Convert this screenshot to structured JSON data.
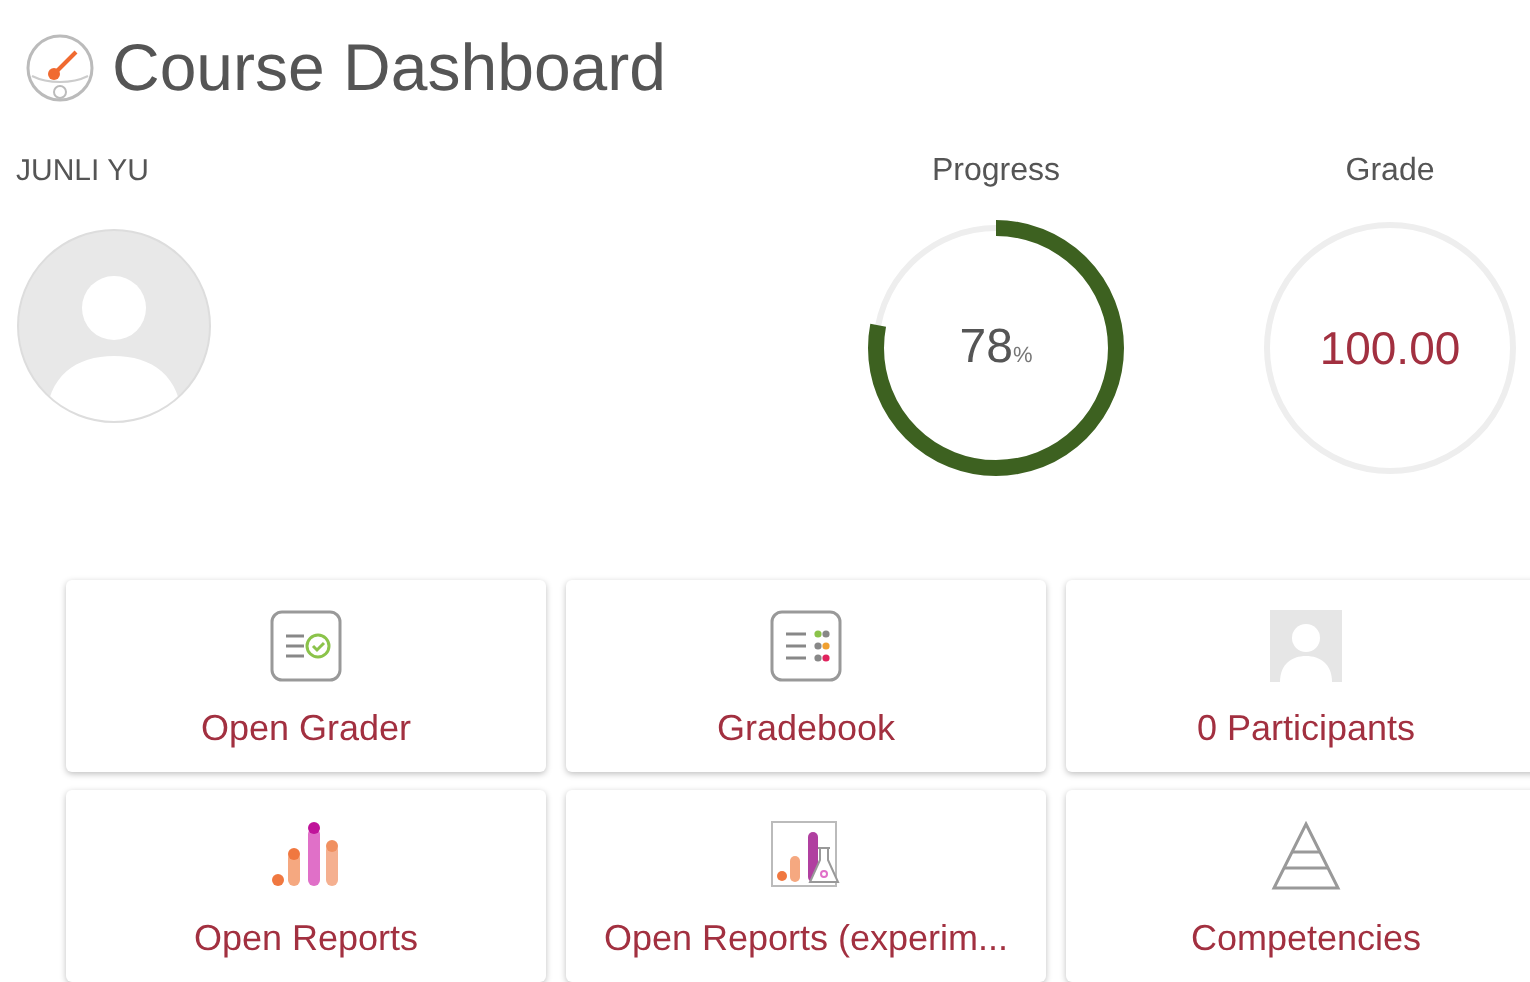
{
  "header": {
    "title": "Course Dashboard"
  },
  "user": {
    "name": "JUNLI YU"
  },
  "progress": {
    "label": "Progress",
    "level": 0.78,
    "value": "78",
    "unit": "%"
  },
  "grade": {
    "label": "Grade",
    "value": "100.00"
  },
  "tiles": [
    {
      "kind": "grader",
      "label": "Open Grader"
    },
    {
      "kind": "gradebook",
      "label": "Gradebook"
    },
    {
      "kind": "participants",
      "label": "0 Participants"
    },
    {
      "kind": "reports",
      "label": "Open Reports"
    },
    {
      "kind": "experimental",
      "label": "Open Reports (experim..."
    },
    {
      "kind": "competencies",
      "label": "Competencies"
    }
  ]
}
